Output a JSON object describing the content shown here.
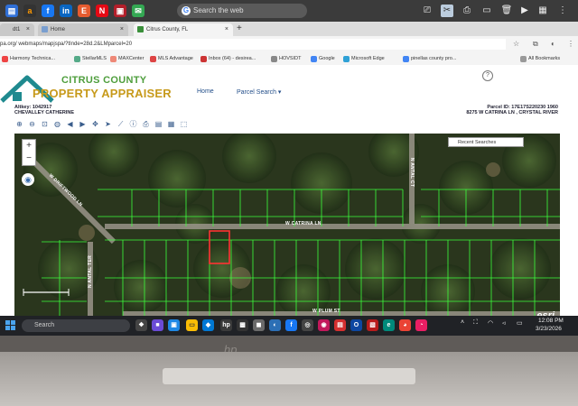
{
  "browser": {
    "system_search_placeholder": "Search the web",
    "tabs": [
      {
        "label": "dt1"
      },
      {
        "label": "Home"
      },
      {
        "label": "Citrus County, FL",
        "active": true
      }
    ],
    "url": "pa.org/ webmaps/mapjspa/?tInde=28d.2&LMparcel=20",
    "bookmarks": [
      "Harmony Technica...",
      "StellarMLS",
      "MAXCenter",
      "MLS Advantage",
      "Inbox (64) - desirea...",
      "HOVSIDT",
      "Google",
      "Microsoft Edge",
      "pinellas county pro..."
    ],
    "all_bookmarks_label": "All Bookmarks"
  },
  "site": {
    "logo_line1": "CITRUS COUNTY",
    "logo_line2": "PROPERTY APPRAISER",
    "nav": {
      "home": "Home",
      "parcel_search": "Parcel Search ▾"
    },
    "help_label": "?",
    "altkey": "Altkey: 1042917",
    "owner": "CHEVALLEY CATHERINE",
    "parcel_id": "Parcel ID: 17E17S220230 1960",
    "address": "8275 W CATRINA LN , CRYSTAL RIVER"
  },
  "map": {
    "zoom_in": "+",
    "zoom_out": "−",
    "recent_label": "Recent Searches",
    "road_w_catrina": "W CATRINA LN",
    "road_diagonal": "W DRIFTWOOD LN",
    "road_left": "N ANTAL TER",
    "road_bottom": "W PLUM ST",
    "road_top_right": "N ANTAL CT",
    "esri": "esri",
    "highlight_color": "#ff3333",
    "parcel_line_color": "#3cff3c"
  },
  "taskbar": {
    "search_label": "Search",
    "time": "12:08 PM",
    "date": "3/23/2026"
  },
  "device": {
    "brand": "hp"
  }
}
